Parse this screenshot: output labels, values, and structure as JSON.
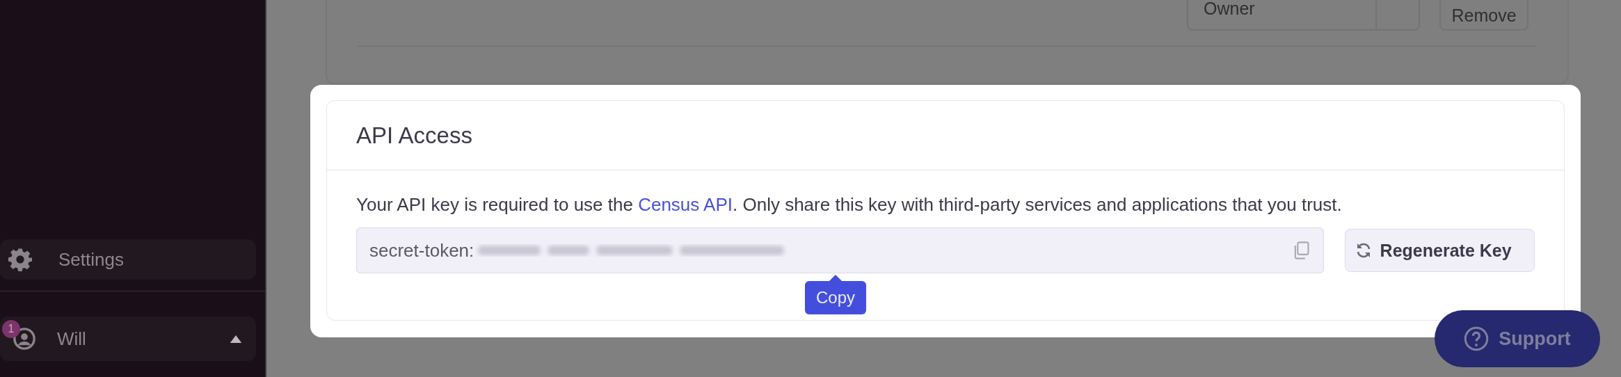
{
  "sidebar": {
    "items": [
      {
        "label": "Settings",
        "kind": "settings"
      }
    ],
    "user": {
      "name": "Will",
      "badge": "1",
      "expanded": true
    }
  },
  "background_card": {
    "role_select": "Owner",
    "remove_button": "Remove"
  },
  "modal": {
    "title": "API Access",
    "description": {
      "before": "Your API key is required to use the ",
      "link": "Census API",
      "after": ". Only share this key with third-party services and applications that you trust."
    },
    "api_key": {
      "value": "secret-token:"
    },
    "regenerate_button": "Regenerate Key",
    "tooltip": "Copy"
  },
  "support_button": "Support"
}
